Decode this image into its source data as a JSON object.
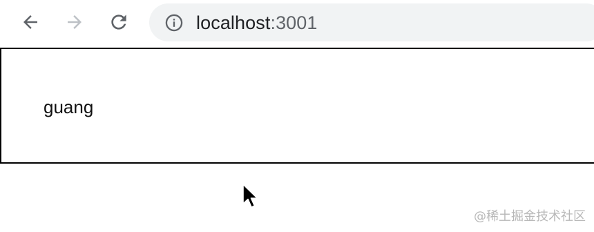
{
  "toolbar": {
    "back_icon": "arrow-left-icon",
    "forward_icon": "arrow-right-icon",
    "reload_icon": "reload-icon",
    "info_icon": "info-circle-icon"
  },
  "address_bar": {
    "host": "localhost",
    "port": ":3001"
  },
  "page": {
    "text": "guang"
  },
  "watermark": {
    "text": "@稀土掘金技术社区"
  },
  "colors": {
    "icon_active": "#5f6368",
    "icon_disabled": "#bdc1c6",
    "omnibox_bg": "#f1f3f4",
    "border": "#000000"
  }
}
